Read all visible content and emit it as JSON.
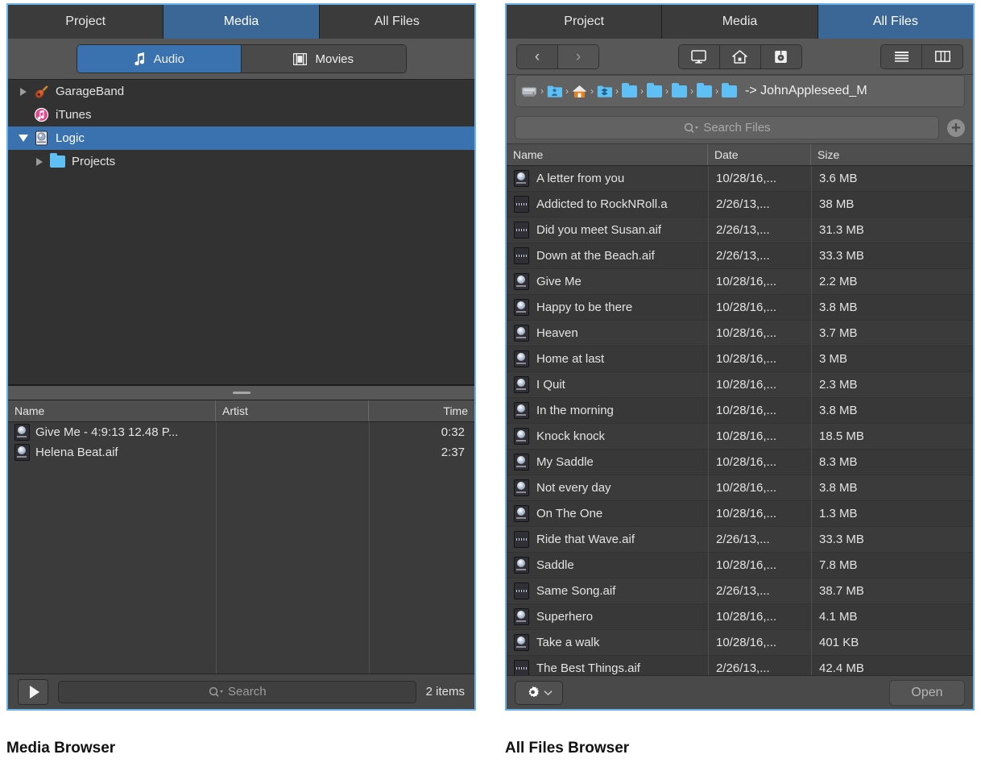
{
  "media_browser": {
    "tabs": [
      {
        "label": "Project",
        "active": false
      },
      {
        "label": "Media",
        "active": true
      },
      {
        "label": "All Files",
        "active": false
      }
    ],
    "segmented": [
      {
        "label": "Audio",
        "icon": "music-note-icon",
        "active": true
      },
      {
        "label": "Movies",
        "icon": "film-strip-icon",
        "active": false
      }
    ],
    "tree": [
      {
        "label": "GarageBand",
        "icon": "guitar-icon",
        "expanded": false,
        "selected": false,
        "indent": 0,
        "twisty": "closed"
      },
      {
        "label": "iTunes",
        "icon": "itunes-icon",
        "expanded": false,
        "selected": false,
        "indent": 0,
        "twisty": "none"
      },
      {
        "label": "Logic",
        "icon": "logic-icon",
        "expanded": true,
        "selected": true,
        "indent": 0,
        "twisty": "open"
      },
      {
        "label": "Projects",
        "icon": "folder-icon",
        "expanded": false,
        "selected": false,
        "indent": 1,
        "twisty": "closed"
      }
    ],
    "table": {
      "columns": [
        "Name",
        "Artist",
        "Time"
      ],
      "rows": [
        {
          "name": "Give Me - 4:9:13 12.48 P...",
          "artist": "",
          "time": "0:32",
          "icon": "logic-project-icon"
        },
        {
          "name": "Helena Beat.aif",
          "artist": "",
          "time": "2:37",
          "icon": "logic-project-icon"
        }
      ]
    },
    "footer": {
      "play_icon": "play-icon",
      "search_placeholder": "Search",
      "search_icon": "search-icon",
      "item_count": "2 items"
    },
    "caption": "Media Browser"
  },
  "all_files_browser": {
    "tabs": [
      {
        "label": "Project",
        "active": false
      },
      {
        "label": "Media",
        "active": false
      },
      {
        "label": "All Files",
        "active": true
      }
    ],
    "toolbar": {
      "back_icon": "chevron-left-icon",
      "forward_icon": "chevron-right-icon",
      "computer_icon": "display-icon",
      "home_icon": "home-icon",
      "disk_icon": "disk-icon",
      "list_view_icon": "list-view-icon",
      "column_view_icon": "column-view-icon"
    },
    "pathbar": {
      "items": [
        {
          "icon": "hard-disk-icon",
          "label": ""
        },
        {
          "icon": "users-folder-icon",
          "label": ""
        },
        {
          "icon": "home-folder-icon",
          "label": ""
        },
        {
          "icon": "dropbox-folder-icon",
          "label": ""
        },
        {
          "icon": "folder-icon",
          "label": ""
        },
        {
          "icon": "folder-icon",
          "label": ""
        },
        {
          "icon": "folder-icon",
          "label": ""
        },
        {
          "icon": "folder-icon",
          "label": ""
        },
        {
          "icon": "folder-icon",
          "label": ""
        }
      ],
      "trailing_text": "-> JohnAppleseed_M"
    },
    "search": {
      "placeholder": "Search Files",
      "search_icon": "search-icon",
      "add_icon": "plus-icon"
    },
    "table": {
      "columns": [
        "Name",
        "Date",
        "Size"
      ],
      "rows": [
        {
          "name": "A letter from you",
          "date": "10/28/16,...",
          "size": "3.6 MB",
          "icon": "logic-project-icon"
        },
        {
          "name": "Addicted to RockNRoll.a",
          "date": "2/26/13,...",
          "size": "38 MB",
          "icon": "audio-waveform-icon"
        },
        {
          "name": "Did you meet Susan.aif",
          "date": "2/26/13,...",
          "size": "31.3 MB",
          "icon": "audio-waveform-icon"
        },
        {
          "name": "Down at the Beach.aif",
          "date": "2/26/13,...",
          "size": "33.3 MB",
          "icon": "audio-waveform-icon"
        },
        {
          "name": "Give Me",
          "date": "10/28/16,...",
          "size": "2.2 MB",
          "icon": "logic-project-icon"
        },
        {
          "name": "Happy to be there",
          "date": "10/28/16,...",
          "size": "3.8 MB",
          "icon": "logic-project-icon"
        },
        {
          "name": "Heaven",
          "date": "10/28/16,...",
          "size": "3.7 MB",
          "icon": "logic-project-icon"
        },
        {
          "name": "Home at last",
          "date": "10/28/16,...",
          "size": "3 MB",
          "icon": "logic-project-icon"
        },
        {
          "name": "I Quit",
          "date": "10/28/16,...",
          "size": "2.3 MB",
          "icon": "logic-project-icon"
        },
        {
          "name": "In the morning",
          "date": "10/28/16,...",
          "size": "3.8 MB",
          "icon": "logic-project-icon"
        },
        {
          "name": "Knock knock",
          "date": "10/28/16,...",
          "size": "18.5 MB",
          "icon": "logic-project-icon"
        },
        {
          "name": "My Saddle",
          "date": "10/28/16,...",
          "size": "8.3 MB",
          "icon": "logic-project-icon"
        },
        {
          "name": "Not every day",
          "date": "10/28/16,...",
          "size": "3.8 MB",
          "icon": "logic-project-icon"
        },
        {
          "name": "On The One",
          "date": "10/28/16,...",
          "size": "1.3 MB",
          "icon": "logic-project-icon"
        },
        {
          "name": "Ride that Wave.aif",
          "date": "2/26/13,...",
          "size": "33.3 MB",
          "icon": "audio-waveform-icon"
        },
        {
          "name": "Saddle",
          "date": "10/28/16,...",
          "size": "7.8 MB",
          "icon": "logic-project-icon"
        },
        {
          "name": "Same Song.aif",
          "date": "2/26/13,...",
          "size": "38.7 MB",
          "icon": "audio-waveform-icon"
        },
        {
          "name": "Superhero",
          "date": "10/28/16,...",
          "size": "4.1 MB",
          "icon": "logic-project-icon"
        },
        {
          "name": "Take a walk",
          "date": "10/28/16,...",
          "size": "401 KB",
          "icon": "logic-project-icon"
        },
        {
          "name": "The Best Things.aif",
          "date": "2/26/13,...",
          "size": "42.4 MB",
          "icon": "audio-waveform-icon"
        }
      ]
    },
    "footer": {
      "gear_icon": "gear-icon",
      "gear_chevron_icon": "chevron-down-icon",
      "open_label": "Open"
    },
    "caption": "All Files Browser"
  },
  "colors": {
    "accent_tab": "#3b6796",
    "accent_segment": "#3a72b0",
    "panel_border": "#6cb3eb",
    "folder_blue": "#5ec0f5",
    "panel_bg": "#3a3a3a",
    "toolbar_bg": "#585858"
  }
}
